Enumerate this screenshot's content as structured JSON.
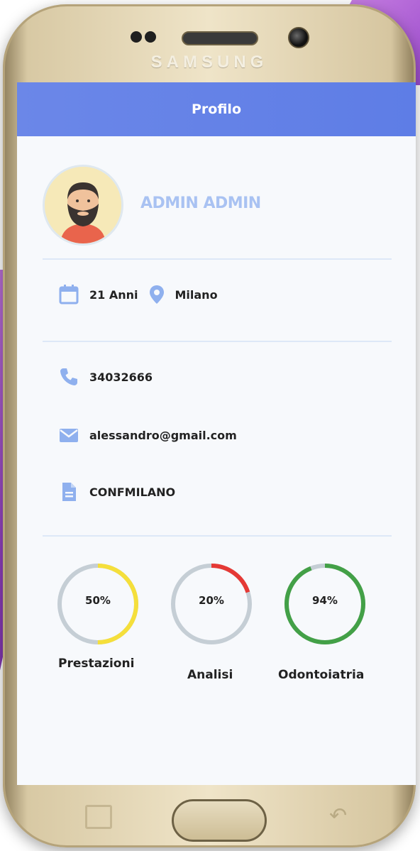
{
  "device": {
    "brand": "SAMSUNG"
  },
  "header": {
    "title": "Profilo"
  },
  "profile": {
    "name": "ADMIN ADMIN"
  },
  "info": {
    "age": "21 Anni",
    "city": "Milano",
    "phone": "34032666",
    "email": "alessandro@gmail.com",
    "code": "CONFMILANO"
  },
  "stats": [
    {
      "value_label": "50%",
      "value": 0.5,
      "label": "Prestazioni",
      "color": "#f5df3b"
    },
    {
      "value_label": "20%",
      "value": 0.2,
      "label": "Analisi",
      "color": "#e53935"
    },
    {
      "value_label": "94%",
      "value": 0.94,
      "label": "Odontoiatria",
      "color": "#43a047"
    }
  ],
  "colors": {
    "accent": "#6b87e8",
    "track": "#c5ced5",
    "icon": "#8fb0ee"
  },
  "icons": [
    "calendar-icon",
    "location-pin-icon",
    "phone-icon",
    "mail-icon",
    "document-icon"
  ]
}
